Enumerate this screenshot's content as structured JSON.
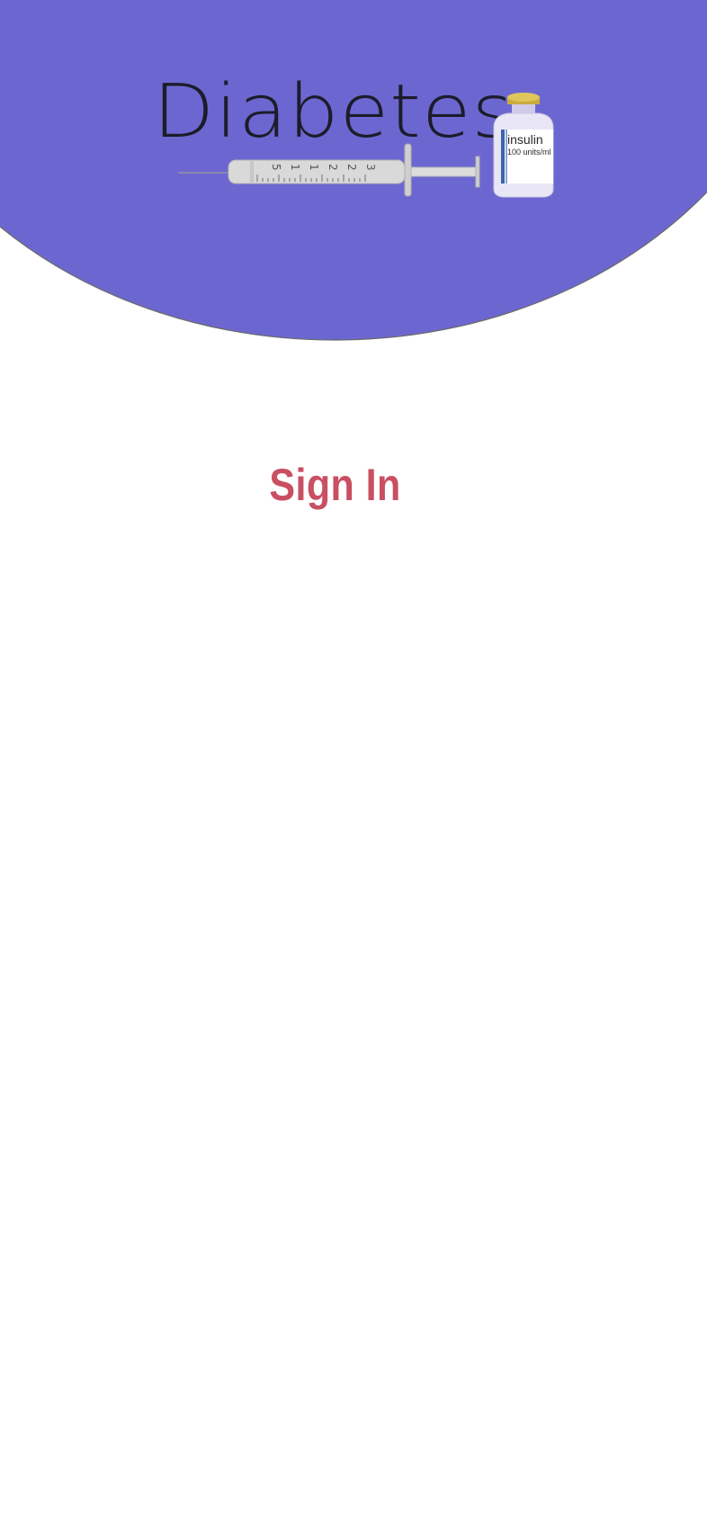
{
  "header": {
    "background_color": "#6c67d0",
    "logo": {
      "word": "Diabetes",
      "syringe_marks": [
        "5",
        "1",
        "1",
        "2",
        "2",
        "3"
      ],
      "vial_label": "insulin",
      "vial_sublabel": "100 units/ml",
      "cap_color": "#d4b84a"
    }
  },
  "main": {
    "title": "Sign In",
    "title_color": "#c94f62"
  }
}
